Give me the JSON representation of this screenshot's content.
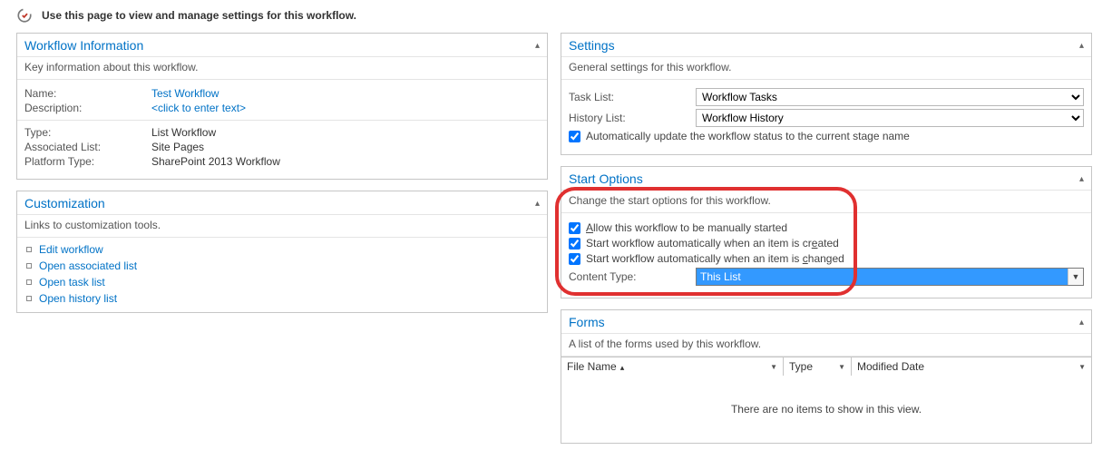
{
  "page_intro": "Use this page to view and manage settings for this workflow.",
  "panels": {
    "info": {
      "title": "Workflow Information",
      "subtitle": "Key information about this workflow.",
      "name_label": "Name:",
      "name_value": "Test Workflow",
      "desc_label": "Description:",
      "desc_placeholder": "<click to enter text>",
      "type_label": "Type:",
      "type_value": "List Workflow",
      "assoc_label": "Associated List:",
      "assoc_value": "Site Pages",
      "plat_label": "Platform Type:",
      "plat_value": "SharePoint 2013 Workflow"
    },
    "custom": {
      "title": "Customization",
      "subtitle": "Links to customization tools.",
      "links": [
        "Edit workflow",
        "Open associated list",
        "Open task list",
        "Open history list"
      ]
    },
    "settings": {
      "title": "Settings",
      "subtitle": "General settings for this workflow.",
      "task_label": "Task List:",
      "task_value": "Workflow Tasks",
      "hist_label": "History List:",
      "hist_value": "Workflow History",
      "auto_update_label": "Automatically update the workflow status to the current stage name"
    },
    "start": {
      "title": "Start Options",
      "subtitle": "Change the start options for this workflow.",
      "opt_manual_pre": "A",
      "opt_manual_post": "llow this workflow to be manually started",
      "opt_created_pre": "Start workflow automatically when an item is cr",
      "opt_created_u": "e",
      "opt_created_post": "ated",
      "opt_changed_pre": "Start workflow automatically when an item is ",
      "opt_changed_u": "c",
      "opt_changed_post": "hanged",
      "ct_label": "Content Type:",
      "ct_value": "This List"
    },
    "forms": {
      "title": "Forms",
      "subtitle": "A list of the forms used by this workflow.",
      "col_file": "File Name",
      "col_type": "Type",
      "col_mod": "Modified Date",
      "empty": "There are no items to show in this view."
    }
  }
}
